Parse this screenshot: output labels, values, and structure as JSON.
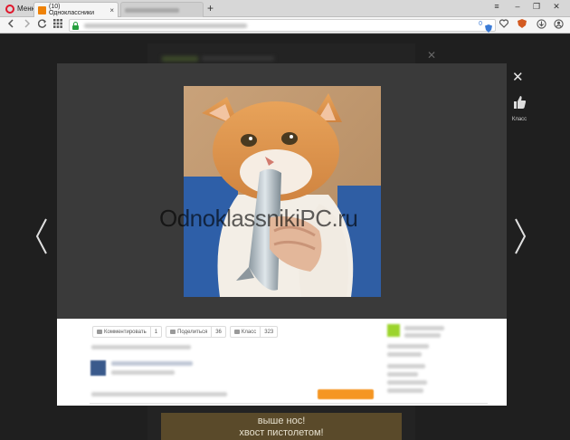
{
  "browser": {
    "menu_label": "Меню",
    "active_tab_title": "(10) Одноклассники",
    "tab_close": "×",
    "new_tab": "+",
    "window_controls": {
      "filter": "≡",
      "minimize": "–",
      "restore": "❐",
      "close": "✕"
    },
    "address_badge": "0"
  },
  "viewer": {
    "close_symbol": "✕",
    "klass_label": "Класс",
    "watermark": "OdnoklassnikiPC.ru"
  },
  "actions": {
    "comment_label": "Комментировать",
    "comment_count": "1",
    "share_label": "Поделиться",
    "share_count": "36",
    "klass_label": "Класс",
    "klass_count": "323"
  },
  "promo": {
    "line1": "выше нос!",
    "line2": "хвост пистолетом!"
  },
  "colors": {
    "accent_orange": "#ee8208",
    "opera_red": "#e0162b",
    "secure_green": "#26a03f"
  }
}
